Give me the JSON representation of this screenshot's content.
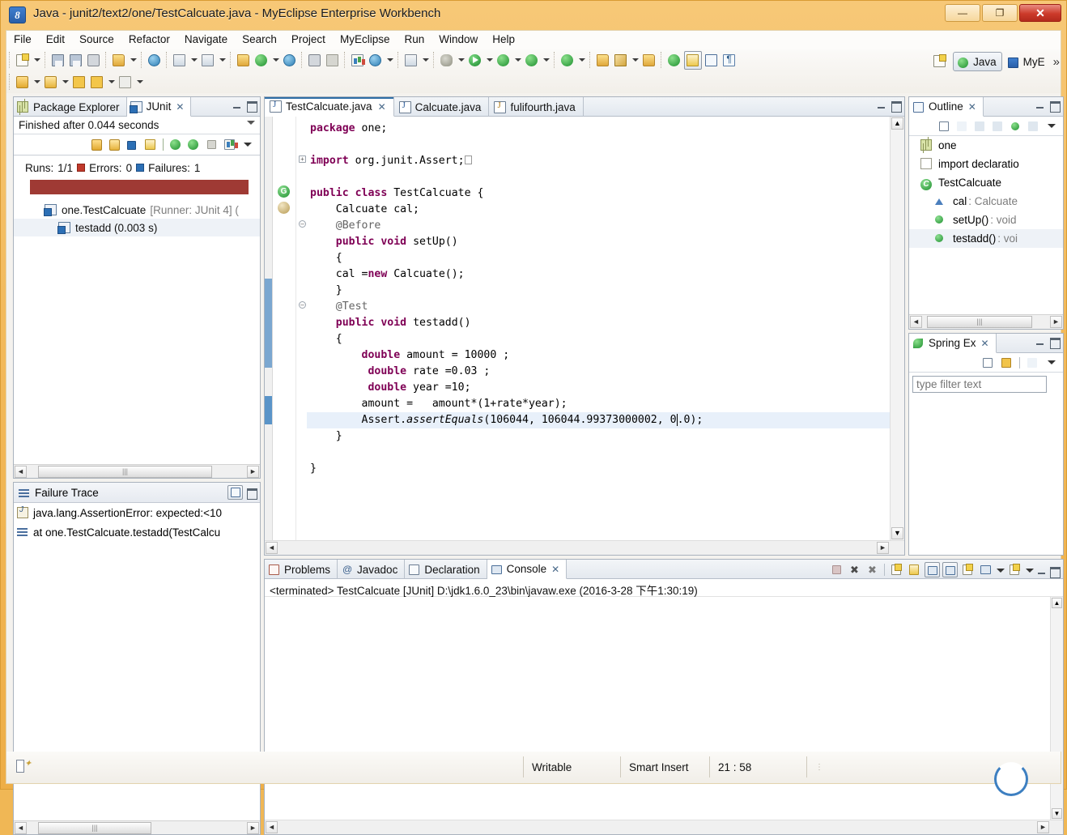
{
  "window": {
    "title": "Java - junit2/text2/one/TestCalcuate.java - MyEclipse Enterprise Workbench",
    "app_icon": "myeclipse-icon",
    "minimize_label": "—",
    "maximize_label": "❐",
    "close_label": "✕"
  },
  "menubar": {
    "items": [
      {
        "label": "File"
      },
      {
        "label": "Edit"
      },
      {
        "label": "Source"
      },
      {
        "label": "Refactor"
      },
      {
        "label": "Navigate"
      },
      {
        "label": "Search"
      },
      {
        "label": "Project"
      },
      {
        "label": "MyEclipse"
      },
      {
        "label": "Run"
      },
      {
        "label": "Window"
      },
      {
        "label": "Help"
      }
    ]
  },
  "perspective": {
    "open_icon": "open-perspective-icon",
    "items": [
      {
        "label": "Java",
        "icon": "java-perspective-icon",
        "active": true
      },
      {
        "label": "MyE",
        "icon": "myeclipse-perspective-icon",
        "active": false
      }
    ],
    "overflow": "»"
  },
  "junit": {
    "tabs": [
      {
        "label": "Package Explorer",
        "icon": "package-explorer-icon",
        "active": false,
        "closable": false
      },
      {
        "label": "JUnit",
        "icon": "junit-icon",
        "active": true,
        "closable": true
      }
    ],
    "status": "Finished after 0.044 seconds",
    "counts": {
      "runs_label": "Runs:",
      "runs_value": "1/1",
      "errors_label": "Errors:",
      "errors_value": "0",
      "failures_label": "Failures:",
      "failures_value": "1"
    },
    "progress_color": "#9f3a34",
    "toolbar_icons": [
      "next-failure-icon",
      "previous-failure-icon",
      "show-failures-only-icon",
      "scroll-lock-icon",
      "rerun-test-icon",
      "rerun-failed-tests-icon",
      "stop-icon",
      "test-run-history-icon",
      "view-menu-icon"
    ],
    "tree": [
      {
        "label": "one.TestCalcuate",
        "suffix": "[Runner: JUnit 4] (",
        "icon": "test-class-failed-icon",
        "indent": 0,
        "selected": false
      },
      {
        "label": "testadd (0.003 s)",
        "suffix": "",
        "icon": "test-method-failed-icon",
        "indent": 1,
        "selected": true
      }
    ]
  },
  "failure_trace": {
    "title": "Failure Trace",
    "icon": "failure-trace-icon",
    "ctrl_icons": [
      "compare-results-icon",
      "maximize-icon"
    ],
    "rows": [
      {
        "icon": "java-exception-icon",
        "text": "java.lang.AssertionError: expected:<10"
      },
      {
        "icon": "stack-frame-icon",
        "text": "at one.TestCalcuate.testadd(TestCalcu"
      }
    ]
  },
  "editor": {
    "tabs": [
      {
        "label": "TestCalcuate.java",
        "icon": "java-file-icon",
        "active": true,
        "closable": true
      },
      {
        "label": "Calcuate.java",
        "icon": "java-file-icon",
        "active": false,
        "closable": false
      },
      {
        "label": "fulifourth.java",
        "icon": "java-file-warning-icon",
        "active": false,
        "closable": false
      }
    ],
    "overlay_icons": [
      "run-marker-icon",
      "edit-marker-icon"
    ],
    "lines": [
      {
        "n": 1,
        "indent": 0,
        "html": "<span class=\"kw\">package</span> one;",
        "folding": "",
        "highlight": false
      },
      {
        "n": 2,
        "indent": 0,
        "html": "",
        "folding": "",
        "highlight": false
      },
      {
        "n": 3,
        "indent": 0,
        "html": "<span class=\"kw\">import</span> org.junit.Assert;□",
        "folding": "plus",
        "highlight": false
      },
      {
        "n": 4,
        "indent": 0,
        "html": "",
        "folding": "",
        "highlight": false
      },
      {
        "n": 5,
        "indent": 0,
        "html": "<span class=\"kw\">public</span> <span class=\"kw\">class</span> TestCalcuate {",
        "folding": "",
        "highlight": false
      },
      {
        "n": 6,
        "indent": 1,
        "html": "    Calcuate cal;",
        "folding": "",
        "highlight": false
      },
      {
        "n": 7,
        "indent": 1,
        "html": "    <span class=\"ann\">@Before</span>",
        "folding": "minus",
        "highlight": false
      },
      {
        "n": 8,
        "indent": 1,
        "html": "    <span class=\"kw\">public</span> <span class=\"kw\">void</span> setUp()",
        "folding": "",
        "highlight": false
      },
      {
        "n": 9,
        "indent": 1,
        "html": "    {",
        "folding": "",
        "highlight": false
      },
      {
        "n": 10,
        "indent": 1,
        "html": "    cal =<span class=\"kw\">new</span> Calcuate();",
        "folding": "",
        "highlight": false
      },
      {
        "n": 11,
        "indent": 1,
        "html": "    }",
        "folding": "",
        "highlight": false
      },
      {
        "n": 12,
        "indent": 1,
        "html": "    <span class=\"ann\">@Test</span>",
        "folding": "minus",
        "highlight": false
      },
      {
        "n": 13,
        "indent": 1,
        "html": "    <span class=\"kw\">public</span> <span class=\"kw\">void</span> testadd()",
        "folding": "",
        "highlight": false
      },
      {
        "n": 14,
        "indent": 1,
        "html": "    {",
        "folding": "",
        "highlight": false
      },
      {
        "n": 15,
        "indent": 2,
        "html": "        <span class=\"kw\">double</span> amount = 10000 ;",
        "folding": "",
        "highlight": false
      },
      {
        "n": 16,
        "indent": 2,
        "html": "         <span class=\"kw\">double</span> rate =0.03 ;",
        "folding": "",
        "highlight": false
      },
      {
        "n": 17,
        "indent": 2,
        "html": "         <span class=\"kw\">double</span> year =10;",
        "folding": "",
        "highlight": false
      },
      {
        "n": 18,
        "indent": 2,
        "html": "        amount =   amount*(1+rate*year);",
        "folding": "",
        "highlight": false
      },
      {
        "n": 19,
        "indent": 2,
        "html": "        Assert.<span class=\"ital\">assertEquals</span>(106044, 106044.99373000002, 0.0);",
        "folding": "",
        "highlight": true
      },
      {
        "n": 20,
        "indent": 1,
        "html": "    }",
        "folding": "",
        "highlight": false
      },
      {
        "n": 21,
        "indent": 0,
        "html": "",
        "folding": "",
        "highlight": false
      },
      {
        "n": 22,
        "indent": 0,
        "html": "}",
        "folding": "",
        "highlight": false
      }
    ]
  },
  "outline": {
    "tab": {
      "label": "Outline",
      "icon": "outline-icon",
      "closable": true
    },
    "toolbar_icons": [
      "collapse-all-icon",
      "sort-icon",
      "hide-fields-icon",
      "hide-static-icon",
      "hide-nonpublic-icon",
      "hide-local-icon",
      "view-menu-icon"
    ],
    "rows": [
      {
        "label": "one",
        "type": "",
        "icon": "package-icon",
        "indent": 0,
        "selected": false
      },
      {
        "label": "import declaratio",
        "type": "",
        "icon": "import-declarations-icon",
        "indent": 0,
        "selected": false
      },
      {
        "label": "TestCalcuate",
        "type": "",
        "icon": "class-icon",
        "indent": 0,
        "selected": false
      },
      {
        "label": "cal",
        "type": " : Calcuate",
        "icon": "field-icon",
        "indent": 1,
        "selected": false
      },
      {
        "label": "setUp()",
        "type": " : void",
        "icon": "method-icon",
        "indent": 1,
        "selected": false
      },
      {
        "label": "testadd()",
        "type": " : voi",
        "icon": "method-icon",
        "indent": 1,
        "selected": true
      }
    ]
  },
  "spring_explorer": {
    "tab": {
      "label": "Spring Ex",
      "icon": "spring-icon",
      "closable": true
    },
    "toolbar_icons": [
      "collapse-all-icon",
      "link-with-editor-icon",
      "sort-icon",
      "view-menu-icon"
    ],
    "filter_placeholder": "type filter text",
    "filter_value": ""
  },
  "console": {
    "tabs": [
      {
        "label": "Problems",
        "icon": "problems-icon",
        "active": false,
        "closable": false
      },
      {
        "label": "Javadoc",
        "icon": "javadoc-icon",
        "active": false,
        "closable": false
      },
      {
        "label": "Declaration",
        "icon": "declaration-icon",
        "active": false,
        "closable": false
      },
      {
        "label": "Console",
        "icon": "console-icon",
        "active": true,
        "closable": true
      }
    ],
    "subtitle": "<terminated> TestCalcuate [JUnit] D:\\jdk1.6.0_23\\bin\\javaw.exe (2016-3-28 下午1:30:19)",
    "output": "",
    "ctrl_icons": [
      "terminate-icon",
      "remove-launch-icon",
      "remove-all-terminated-icon",
      "clear-console-icon",
      "scroll-lock-icon",
      "show-console-on-output-icon",
      "pin-console-icon",
      "new-console-view-icon",
      "display-selected-console-icon",
      "open-console-icon",
      "minimize-icon",
      "maximize-icon"
    ]
  },
  "statusbar": {
    "left_icon": "smart-insert-indicator-icon",
    "writable": "Writable",
    "insert_mode": "Smart Insert",
    "position": "21 : 58"
  },
  "toolbar": {
    "row1": [
      {
        "icon": "new-wizard-icon",
        "arrow": true
      },
      {
        "sep": true
      },
      {
        "icon": "save-icon",
        "arrow": false
      },
      {
        "icon": "save-all-icon",
        "arrow": false
      },
      {
        "icon": "print-icon",
        "arrow": false
      },
      {
        "sep": true
      },
      {
        "icon": "myeclipse-web-icon",
        "arrow": true
      },
      {
        "sep": true
      },
      {
        "icon": "web-20-icon",
        "arrow": false
      },
      {
        "sep": true
      },
      {
        "icon": "deploy-icon",
        "arrow": true
      },
      {
        "icon": "database-explorer-icon",
        "arrow": true
      },
      {
        "sep": true
      },
      {
        "icon": "import-icon",
        "arrow": false
      },
      {
        "icon": "run-server-icon",
        "arrow": true
      },
      {
        "icon": "globe-icon",
        "arrow": false
      },
      {
        "sep": true
      },
      {
        "icon": "export-icon",
        "arrow": false
      },
      {
        "icon": "build-icon",
        "arrow": false
      },
      {
        "sep": true
      },
      {
        "icon": "report-icon",
        "arrow": false
      },
      {
        "icon": "uml-icon",
        "arrow": true
      },
      {
        "sep": true
      },
      {
        "icon": "snapshot-icon",
        "arrow": true
      },
      {
        "sep": true
      },
      {
        "icon": "debug-icon",
        "arrow": true
      },
      {
        "icon": "run-icon",
        "arrow": true
      },
      {
        "icon": "run-history-icon",
        "arrow": true
      },
      {
        "icon": "external-tools-icon",
        "arrow": true
      },
      {
        "sep": true
      },
      {
        "icon": "new-package-icon",
        "arrow": false
      },
      {
        "icon": "new-class-icon",
        "arrow": true
      },
      {
        "sep": true
      },
      {
        "icon": "open-type-icon",
        "arrow": false
      },
      {
        "icon": "search-icon",
        "arrow": true
      },
      {
        "icon": "open-task-icon",
        "arrow": false
      },
      {
        "sep": true
      },
      {
        "icon": "next-annotation-icon",
        "arrow": false
      },
      {
        "icon": "toggle-markoccurrences-icon",
        "arrow": false
      },
      {
        "icon": "toggle-block-selection-icon",
        "arrow": false
      },
      {
        "icon": "show-whitespace-icon",
        "arrow": false
      }
    ],
    "row2": [
      {
        "icon": "next-annotation-icon",
        "arrow": true
      },
      {
        "icon": "previous-annotation-icon",
        "arrow": true
      },
      {
        "icon": "last-edit-location-icon",
        "arrow": false
      },
      {
        "icon": "back-icon",
        "arrow": true
      },
      {
        "icon": "forward-icon",
        "arrow": true
      }
    ]
  }
}
